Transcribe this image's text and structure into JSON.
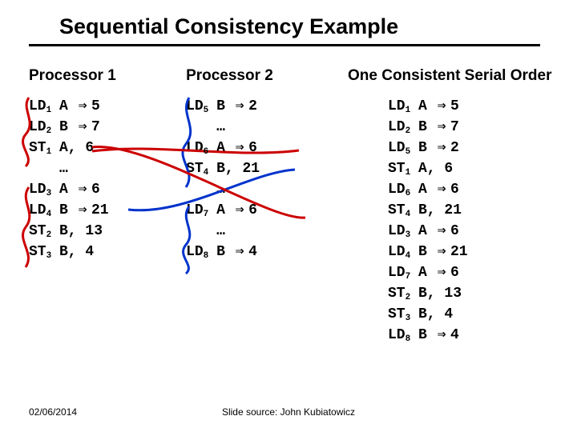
{
  "title": "Sequential Consistency Example",
  "columns": {
    "p1": {
      "heading": "Processor 1"
    },
    "p2": {
      "heading": "Processor 2"
    },
    "order": {
      "heading": "One Consistent Serial Order"
    }
  },
  "arrow": "⇒",
  "ellipsis": "…",
  "p1": {
    "r1": {
      "op": "LD",
      "sub": "1",
      "reg": "A",
      "val": "5"
    },
    "r2": {
      "op": "LD",
      "sub": "2",
      "reg": "B",
      "val": "7"
    },
    "r3": {
      "op": "ST",
      "sub": "1",
      "stv": "A, 6"
    },
    "r4": {
      "op": "LD",
      "sub": "3",
      "reg": "A",
      "val": "6"
    },
    "r5": {
      "op": "LD",
      "sub": "4",
      "reg": "B",
      "val": "21"
    },
    "r6": {
      "op": "ST",
      "sub": "2",
      "stv": "B, 13"
    },
    "r7": {
      "op": "ST",
      "sub": "3",
      "stv": "B, 4"
    }
  },
  "p2": {
    "r1": {
      "op": "LD",
      "sub": "5",
      "reg": "B",
      "val": "2"
    },
    "r2": {
      "op": "LD",
      "sub": "6",
      "reg": "A",
      "val": "6"
    },
    "r3": {
      "op": "ST",
      "sub": "4",
      "stv": "B, 21"
    },
    "r4": {
      "op": "LD",
      "sub": "7",
      "reg": "A",
      "val": "6"
    },
    "r5": {
      "op": "LD",
      "sub": "8",
      "reg": "B",
      "val": "4"
    }
  },
  "order": {
    "r1": {
      "op": "LD",
      "sub": "1",
      "reg": "A",
      "val": "5"
    },
    "r2": {
      "op": "LD",
      "sub": "2",
      "reg": "B",
      "val": "7"
    },
    "r3": {
      "op": "LD",
      "sub": "5",
      "reg": "B",
      "val": "2"
    },
    "r4": {
      "op": "ST",
      "sub": "1",
      "stv": "A, 6"
    },
    "r5": {
      "op": "LD",
      "sub": "6",
      "reg": "A",
      "val": "6"
    },
    "r6": {
      "op": "ST",
      "sub": "4",
      "stv": "B, 21"
    },
    "r7": {
      "op": "LD",
      "sub": "3",
      "reg": "A",
      "val": "6"
    },
    "r8": {
      "op": "LD",
      "sub": "4",
      "reg": "B",
      "val": "21"
    },
    "r9": {
      "op": "LD",
      "sub": "7",
      "reg": "A",
      "val": "6"
    },
    "r10": {
      "op": "ST",
      "sub": "2",
      "stv": "B, 13"
    },
    "r11": {
      "op": "ST",
      "sub": "3",
      "stv": "B, 4"
    },
    "r12": {
      "op": "LD",
      "sub": "8",
      "reg": "B",
      "val": "4"
    }
  },
  "footer": {
    "date": "02/06/2014",
    "source": "Slide source: John Kubiatowicz"
  },
  "accent": {
    "st1": "#cc0000",
    "st4": "#0033cc"
  }
}
